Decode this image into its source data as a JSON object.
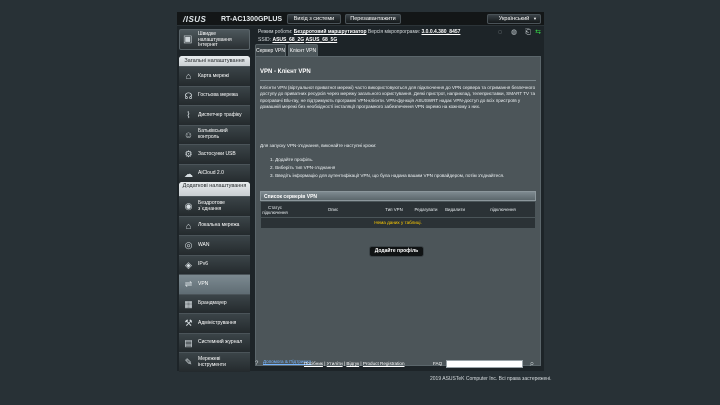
{
  "brand": "/ISUS",
  "model": "RT-AC1300GPLUS",
  "topbar": {
    "logout_label": "Вихід з системи",
    "reboot_label": "Перезавантажити",
    "language": "Український"
  },
  "status": {
    "mode_label": "Режим роботи:",
    "mode_value": "Бездротовий маршрутизатор",
    "firmware_label": "Версія мікропрограми:",
    "firmware_value": "3.0.0.4.380_8457",
    "ssid_label": "SSID:",
    "ssid_1": "ASUS_68_2G",
    "ssid_2": "ASUS_68_5G"
  },
  "sidebar": {
    "quick_setup": "Швидке налаштування Інтернет",
    "general_title": "Загальні налаштування",
    "general_items": [
      {
        "label": "Карта мережі",
        "icon": "network-map-icon"
      },
      {
        "label": "Гостьова мережа",
        "icon": "guest-network-icon"
      },
      {
        "label": "Диспетчер трафіку",
        "icon": "traffic-manager-icon"
      },
      {
        "label": "Батьківський контроль",
        "icon": "parental-control-icon"
      },
      {
        "label": "Застосунки USB",
        "icon": "usb-icon"
      },
      {
        "label": "AiCloud 2.0",
        "icon": "cloud-icon"
      }
    ],
    "advanced_title": "Додаткові налаштування",
    "advanced_items": [
      {
        "label": "Бездротове з`єднання",
        "icon": "wireless-icon"
      },
      {
        "label": "Локальна мережа",
        "icon": "lan-icon"
      },
      {
        "label": "WAN",
        "icon": "wan-icon"
      },
      {
        "label": "IPv6",
        "icon": "ipv6-icon"
      },
      {
        "label": "VPN",
        "icon": "vpn-icon"
      },
      {
        "label": "Брандмауер",
        "icon": "firewall-icon"
      },
      {
        "label": "Адміністрування",
        "icon": "admin-icon"
      },
      {
        "label": "Системний журнал",
        "icon": "syslog-icon"
      },
      {
        "label": "Мережеві інструменти",
        "icon": "network-tools-icon"
      }
    ]
  },
  "tabs": [
    "Сервер VPN",
    "Клієнт VPN"
  ],
  "main": {
    "title": "VPN - Клієнт VPN",
    "description": "Клієнти VPN (віртуальної приватної мережі) часто використовуються для підключення до VPN сервера та отримання безпечного доступу до приватних ресурсів через мережу загального користування. Деякі пристрої, наприклад, телеприставки, SMART TV та програвачі Blu-ray, не підтримують програмні VPN-клієнти. VPN-функція ASUSWRT надає VPN-доступ до всіх пристроїв у домашній мережі без необхідності інсталяції програмного забезпечення VPN окремо на кожному з них.",
    "steps_intro": "Для запуску VPN-з'єднання, виконайте наступні кроки:",
    "steps": [
      "1. Додайте профіль.",
      "2. Виберіть тип VPN-з'єднання",
      "3. Введіть інформацію для аутентифікації VPN, що була надана вашим VPN провайдером, потім з'єднайтеся."
    ],
    "list_title": "Список серверів VPN",
    "columns": [
      "Статус підключення",
      "Опис",
      "Тип VPN",
      "Редагувати",
      "Видалити",
      "підключення"
    ],
    "no_data": "Нема даних у таблиці.",
    "add_profile": "Додайте профіль"
  },
  "footer": {
    "help": "Допомога & Підтримка",
    "links": [
      "Посібник",
      "Утиліти",
      "Відгук",
      "Product Registration"
    ],
    "faq": "FAQ"
  },
  "copyright": "2019 ASUSTeK Computer Inc. Всі права застережені."
}
